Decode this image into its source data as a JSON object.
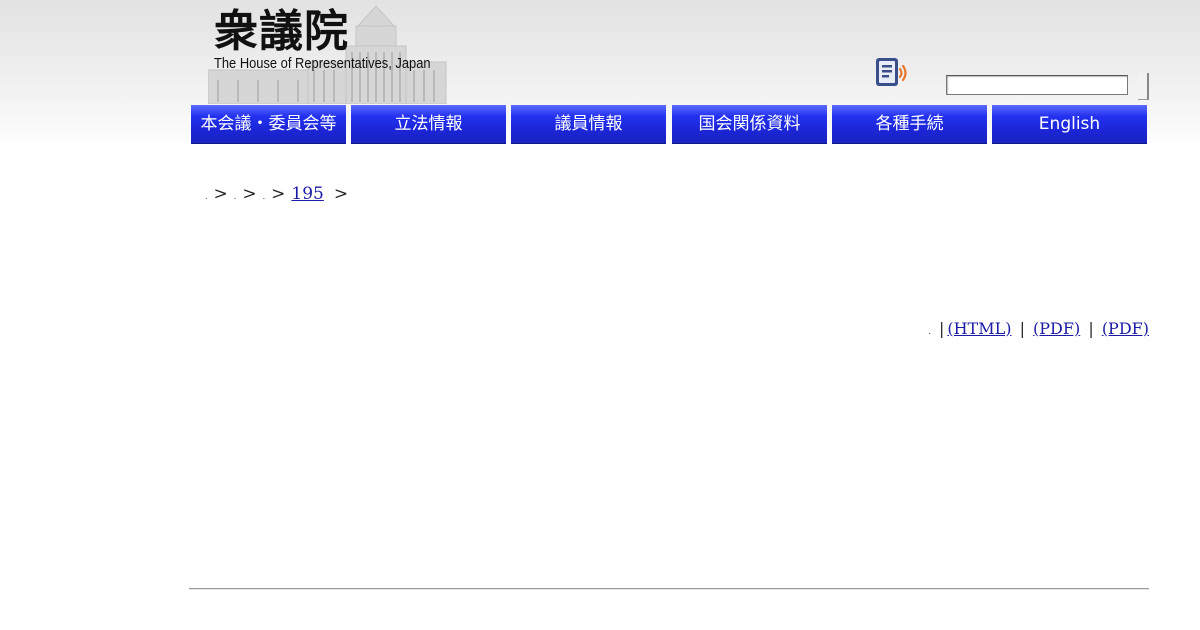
{
  "header": {
    "logo_kanji": "衆議院",
    "logo_english": "The House of Representatives, Japan",
    "search": {
      "value": "",
      "placeholder": ""
    }
  },
  "nav": {
    "items": [
      {
        "label": "本会議・委員会等"
      },
      {
        "label": "立法情報"
      },
      {
        "label": "議員情報"
      },
      {
        "label": "国会関係資料"
      },
      {
        "label": "各種手続"
      },
      {
        "label": "English"
      }
    ]
  },
  "breadcrumb": {
    "crumb1": ".",
    "crumb2": ".",
    "crumb3": ".",
    "separator": ">",
    "session_link": "195"
  },
  "doc_links": {
    "dot": ".",
    "separator": "|",
    "html": "(HTML)",
    "pdf1": "(PDF)",
    "pdf2": "(PDF)"
  },
  "colors": {
    "nav_blue": "#1b25d4",
    "link_blue": "#1a1aa6",
    "icon_orange": "#e8762b",
    "icon_navy": "#3a4f8a"
  },
  "icons": {
    "voice": "speech-reader-icon"
  }
}
